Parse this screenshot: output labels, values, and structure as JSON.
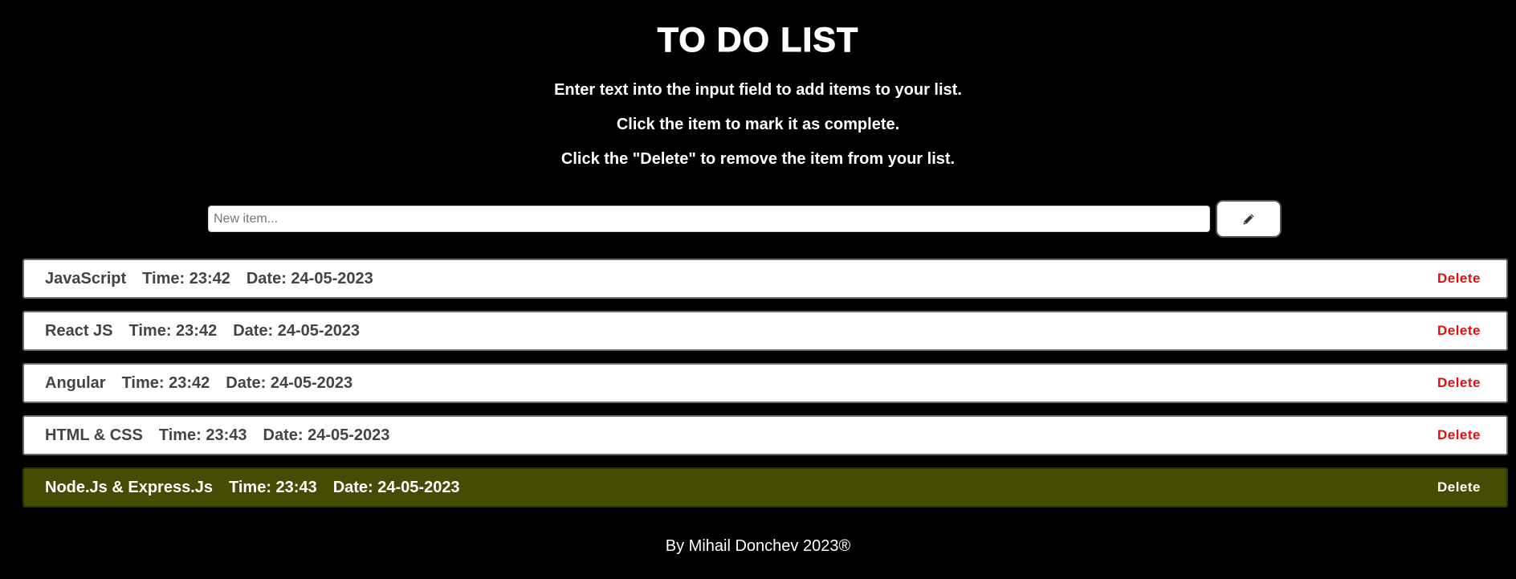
{
  "header": {
    "title": "TO DO LIST",
    "instructions": [
      "Enter text into the input field to add items to your list.",
      "Click the item to mark it as complete.",
      "Click the \"Delete\" to remove the item from your list."
    ]
  },
  "input": {
    "placeholder": "New item...",
    "value": "",
    "button_icon": "pencil-icon"
  },
  "items": [
    {
      "text": "JavaScript",
      "time": "Time: 23:42",
      "date": "Date: 24-05-2023",
      "delete_label": "Delete",
      "completed": false
    },
    {
      "text": "React JS",
      "time": "Time: 23:42",
      "date": "Date: 24-05-2023",
      "delete_label": "Delete",
      "completed": false
    },
    {
      "text": "Angular",
      "time": "Time: 23:42",
      "date": "Date: 24-05-2023",
      "delete_label": "Delete",
      "completed": false
    },
    {
      "text": "HTML & CSS",
      "time": "Time: 23:43",
      "date": "Date: 24-05-2023",
      "delete_label": "Delete",
      "completed": false
    },
    {
      "text": "Node.Js & Express.Js",
      "time": "Time: 23:43",
      "date": "Date: 24-05-2023",
      "delete_label": "Delete",
      "completed": true
    }
  ],
  "footer": {
    "text": "By Mihail Donchev 2023®"
  },
  "colors": {
    "background": "#000000",
    "item_background": "#ffffff",
    "completed_background": "#454d05",
    "delete_color": "#e01010"
  }
}
